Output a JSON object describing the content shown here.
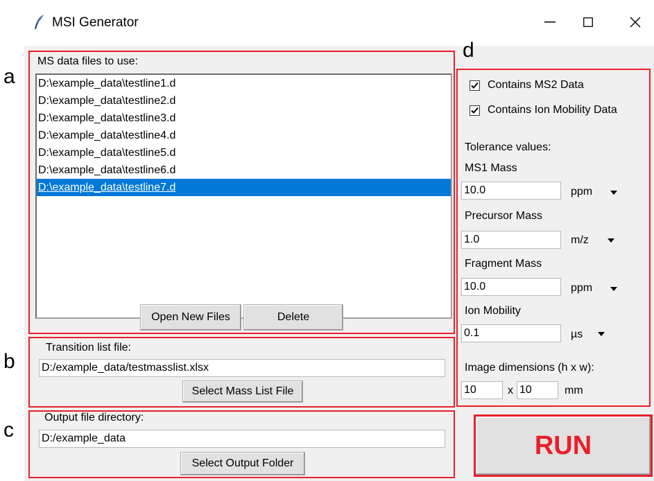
{
  "window": {
    "title": "MSI Generator"
  },
  "panel_labels": {
    "a": "a",
    "b": "b",
    "c": "c",
    "d": "d"
  },
  "files_section": {
    "title": "MS data files to use:",
    "files": [
      "D:\\example_data\\testline1.d",
      "D:\\example_data\\testline2.d",
      "D:\\example_data\\testline3.d",
      "D:\\example_data\\testline4.d",
      "D:\\example_data\\testline5.d",
      "D:\\example_data\\testline6.d",
      "D:\\example_data\\testline7.d"
    ],
    "selected_index": 6,
    "open_button": "Open New Files",
    "delete_button": "Delete"
  },
  "transition_section": {
    "title": "Transition list file:",
    "path": "D:/example_data/testmasslist.xlsx",
    "select_button": "Select Mass List File"
  },
  "output_section": {
    "title": "Output file directory:",
    "path": "D:/example_data",
    "select_button": "Select Output Folder"
  },
  "options": {
    "ms2_label": "Contains MS2 Data",
    "ms2_checked": true,
    "ion_mobility_label": "Contains Ion Mobility Data",
    "ion_mobility_checked": true,
    "tolerance_title": "Tolerance values:",
    "ms1": {
      "label": "MS1 Mass",
      "value": "10.0",
      "unit": "ppm"
    },
    "precursor": {
      "label": "Precursor Mass",
      "value": "1.0",
      "unit": "m/z"
    },
    "fragment": {
      "label": "Fragment Mass",
      "value": "10.0",
      "unit": "ppm"
    },
    "ion_mob": {
      "label": "Ion Mobility",
      "value": "0.1",
      "unit": "µs"
    },
    "dimensions": {
      "label": "Image dimensions (h x w):",
      "h": "10",
      "sep": "x",
      "w": "10",
      "unit": "mm"
    }
  },
  "run_button": "RUN",
  "colors": {
    "highlight": "#e8202a",
    "selection": "#0078d7"
  },
  "icons": [
    "feather-icon",
    "minimize-icon",
    "maximize-icon",
    "close-icon",
    "checkmark-icon",
    "dropdown-arrow-icon"
  ]
}
